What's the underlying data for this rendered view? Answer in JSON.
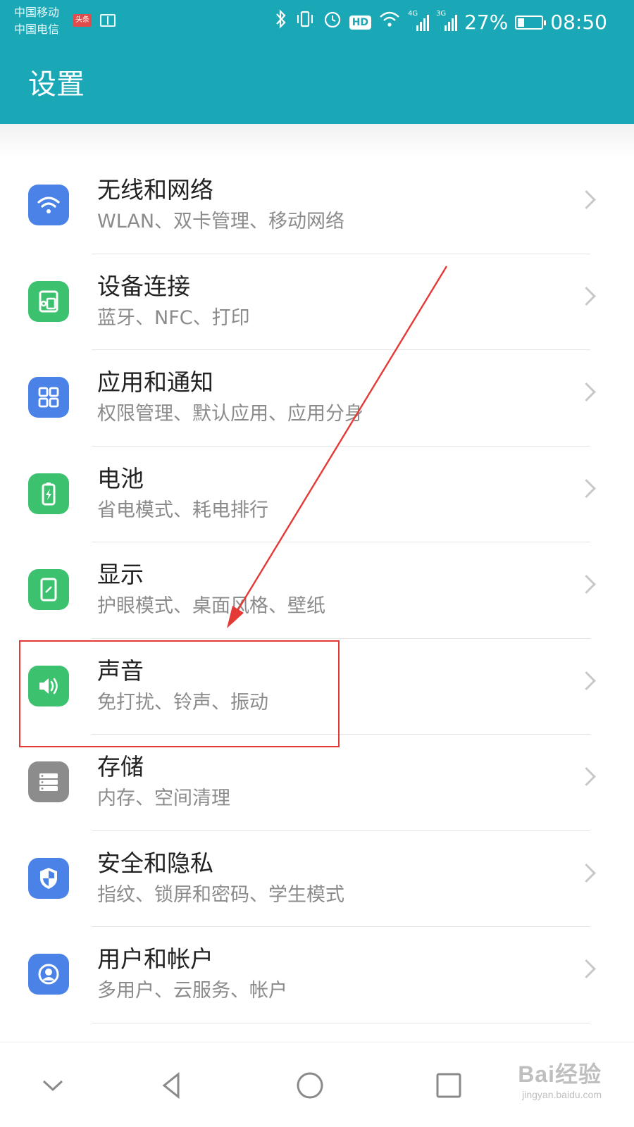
{
  "status_bar": {
    "carrier1": "中国移动",
    "carrier2": "中国电信",
    "app_badge": "头条",
    "network1": "4G",
    "network2": "3G",
    "battery_text": "27%",
    "battery_level": 0.27,
    "time": "08:50",
    "hd": "HD",
    "icons": [
      "bluetooth-icon",
      "vibrate-icon",
      "alarm-icon",
      "hd-icon",
      "wifi-icon",
      "signal-icon",
      "battery-icon"
    ]
  },
  "header": {
    "title": "设置"
  },
  "menu": [
    {
      "name": "无线和网络",
      "sub": "WLAN、双卡管理、移动网络",
      "icon": "wifi-icon",
      "color": "#4a82e8"
    },
    {
      "name": "设备连接",
      "sub": "蓝牙、NFC、打印",
      "icon": "device-connect-icon",
      "color": "#3cc26e"
    },
    {
      "name": "应用和通知",
      "sub": "权限管理、默认应用、应用分身",
      "icon": "apps-icon",
      "color": "#4a82e8"
    },
    {
      "name": "电池",
      "sub": "省电模式、耗电排行",
      "icon": "battery-icon",
      "color": "#3cc26e"
    },
    {
      "name": "显示",
      "sub": "护眼模式、桌面风格、壁纸",
      "icon": "display-icon",
      "color": "#3cc26e"
    },
    {
      "name": "声音",
      "sub": "免打扰、铃声、振动",
      "icon": "speaker-icon",
      "color": "#3cc26e"
    },
    {
      "name": "存储",
      "sub": "内存、空间清理",
      "icon": "storage-icon",
      "color": "#8c8c8c"
    },
    {
      "name": "安全和隐私",
      "sub": "指纹、锁屏和密码、学生模式",
      "icon": "shield-icon",
      "color": "#4a82e8"
    },
    {
      "name": "用户和帐户",
      "sub": "多用户、云服务、帐户",
      "icon": "user-icon",
      "color": "#4a82e8"
    }
  ],
  "annotation": {
    "color": "#e53935",
    "highlighted_item": "声音"
  },
  "navbar": {
    "icons": [
      "chevron-down-icon",
      "back-icon",
      "home-icon",
      "recents-icon"
    ]
  },
  "watermark": {
    "line1": "Bai经验",
    "line2": "jingyan.baidu.com"
  }
}
